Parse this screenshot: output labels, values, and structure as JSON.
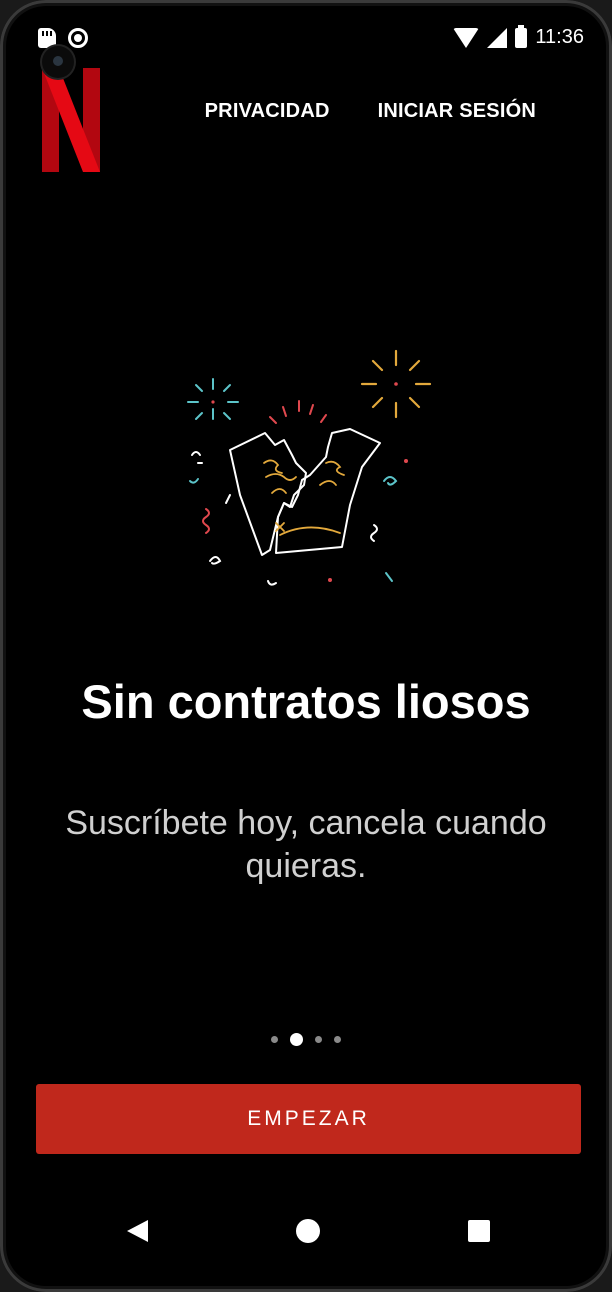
{
  "status_bar": {
    "time": "11:36",
    "icons": [
      "sd-card-icon",
      "record-icon",
      "wifi-icon",
      "signal-icon",
      "battery-icon"
    ]
  },
  "brand": {
    "logo": "netflix-logo",
    "color": "#e50914"
  },
  "nav": {
    "privacy": "PRIVACIDAD",
    "sign_in": "INICIAR SESIÓN"
  },
  "onboarding": {
    "headline": "Sin contratos liosos",
    "subtext": "Suscríbete hoy, cancela cuando quieras.",
    "illustration": "broken-contract-confetti-illustration",
    "page_count": 4,
    "active_page": 2
  },
  "cta": {
    "label": "EMPEZAR",
    "color": "#c0281c"
  },
  "system_nav": {
    "icons": [
      "back-icon",
      "home-icon",
      "recents-icon"
    ]
  }
}
